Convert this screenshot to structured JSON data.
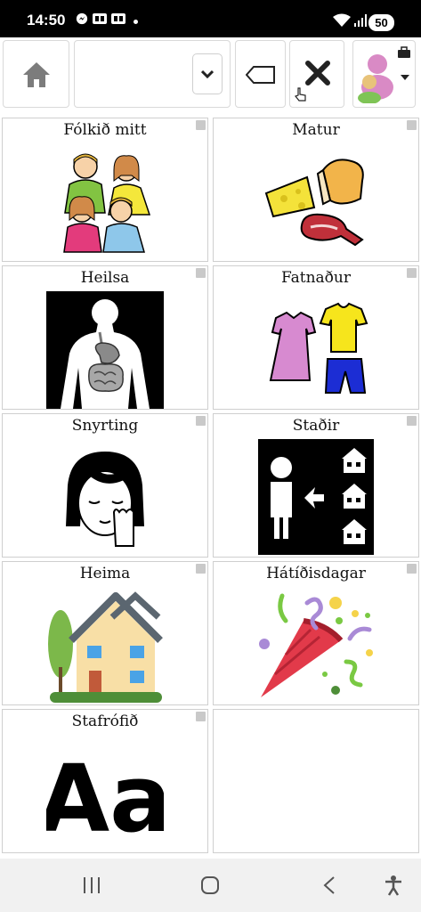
{
  "status": {
    "time": "14:50",
    "battery": "50"
  },
  "toolbar": {
    "input_value": ""
  },
  "tiles": [
    {
      "label": "Fólkið mitt"
    },
    {
      "label": "Matur"
    },
    {
      "label": "Heilsa"
    },
    {
      "label": "Fatnaður"
    },
    {
      "label": "Snyrting"
    },
    {
      "label": "Staðir"
    },
    {
      "label": "Heima"
    },
    {
      "label": "Hátíðisdagar"
    },
    {
      "label": "Stafrófið"
    }
  ],
  "alphabet_glyph": "Aa",
  "colors": {
    "statusbar": "#000000",
    "tile_border": "#cfcfcf",
    "navbar": "#f1f1f1"
  }
}
